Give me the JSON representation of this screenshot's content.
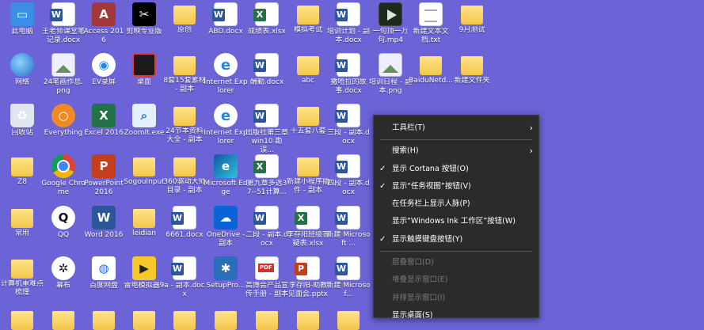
{
  "desktop": {
    "icons": [
      {
        "label": "此电脑",
        "kind": "pc",
        "glyph": "▭"
      },
      {
        "label": "王老师课堂笔记录.docx",
        "kind": "word",
        "glyph": ""
      },
      {
        "label": "Access 2016",
        "kind": "access",
        "glyph": "A"
      },
      {
        "label": "剪映专业版",
        "kind": "capcut",
        "glyph": "✂"
      },
      {
        "label": "原创",
        "kind": "folder",
        "glyph": ""
      },
      {
        "label": "ABD.docx",
        "kind": "word",
        "glyph": ""
      },
      {
        "label": "成绩表.xlsx",
        "kind": "excel",
        "glyph": ""
      },
      {
        "label": "模拟考试",
        "kind": "folder",
        "glyph": ""
      },
      {
        "label": "培训计划 - 副本.docx",
        "kind": "word",
        "glyph": ""
      },
      {
        "label": "一句顶一万句.mp4",
        "kind": "video",
        "glyph": ""
      },
      {
        "label": "新建文本文档.txt",
        "kind": "txt",
        "glyph": ""
      },
      {
        "label": "9月测试",
        "kind": "folder",
        "glyph": ""
      },
      {
        "label": "网络",
        "kind": "globe",
        "glyph": ""
      },
      {
        "label": "24笔画作息.png",
        "kind": "img",
        "glyph": ""
      },
      {
        "label": "EV录屏",
        "kind": "ev",
        "glyph": "◉"
      },
      {
        "label": "桌面",
        "kind": "dark",
        "glyph": ""
      },
      {
        "label": "8套15套素材 - 副本",
        "kind": "folder",
        "glyph": ""
      },
      {
        "label": "Internet Explorer",
        "kind": "ie",
        "glyph": "e"
      },
      {
        "label": "酬勤.docx",
        "kind": "word",
        "glyph": ""
      },
      {
        "label": "abc",
        "kind": "folder",
        "glyph": ""
      },
      {
        "label": "撒哈拉的故事.docx",
        "kind": "word",
        "glyph": ""
      },
      {
        "label": "培训日程 - 副本.png",
        "kind": "img",
        "glyph": ""
      },
      {
        "label": "BaiduNetd...",
        "kind": "folder",
        "glyph": ""
      },
      {
        "label": "新建文件夹",
        "kind": "folder",
        "glyph": ""
      },
      {
        "label": "回收站",
        "kind": "bin",
        "glyph": "♻"
      },
      {
        "label": "Everything",
        "kind": "everything",
        "glyph": "○"
      },
      {
        "label": "Excel 2016",
        "kind": "excel16",
        "glyph": "X"
      },
      {
        "label": "ZoomIt.exe",
        "kind": "zoom",
        "glyph": "⌕"
      },
      {
        "label": "24节本资料大全 - 副本",
        "kind": "folder",
        "glyph": ""
      },
      {
        "label": "Internet Explorer",
        "kind": "ie",
        "glyph": "e"
      },
      {
        "label": "出版社第三章win10 勘误...",
        "kind": "word",
        "glyph": ""
      },
      {
        "label": "十五套八套",
        "kind": "folder",
        "glyph": ""
      },
      {
        "label": "三段 - 副本.docx",
        "kind": "word",
        "glyph": ""
      },
      {
        "label": "Z8",
        "kind": "folder",
        "glyph": ""
      },
      {
        "label": "Google Chrome",
        "kind": "chrome",
        "glyph": ""
      },
      {
        "label": "PowerPoint 2016",
        "kind": "ppt16",
        "glyph": "P"
      },
      {
        "label": "SogouInput",
        "kind": "folder",
        "glyph": ""
      },
      {
        "label": "360驱动大师目录 - 副本",
        "kind": "folder",
        "glyph": ""
      },
      {
        "label": "Microsoft Edge",
        "kind": "edge",
        "glyph": "e"
      },
      {
        "label": "第九章多选37--51计算...",
        "kind": "excel",
        "glyph": ""
      },
      {
        "label": "新建小程序插件 - 副本",
        "kind": "folder",
        "glyph": ""
      },
      {
        "label": "四段 - 副本.docx",
        "kind": "word",
        "glyph": ""
      },
      {
        "label": "常用",
        "kind": "folder",
        "glyph": ""
      },
      {
        "label": "QQ",
        "kind": "qq",
        "glyph": "Q"
      },
      {
        "label": "Word 2016",
        "kind": "word16",
        "glyph": "W"
      },
      {
        "label": "leidian",
        "kind": "folder",
        "glyph": ""
      },
      {
        "label": "6661.docx",
        "kind": "word",
        "glyph": ""
      },
      {
        "label": "OneDrive - 副本",
        "kind": "onedrive",
        "glyph": "☁"
      },
      {
        "label": "二段 - 副本.docx",
        "kind": "word",
        "glyph": ""
      },
      {
        "label": "李存阳班级答疑表.xlsx",
        "kind": "excel",
        "glyph": ""
      },
      {
        "label": "新建 Microsoft ...",
        "kind": "word",
        "glyph": ""
      },
      {
        "label": "计算机重难点梳理",
        "kind": "folder",
        "glyph": ""
      },
      {
        "label": "幕布",
        "kind": "fly",
        "glyph": "✲"
      },
      {
        "label": "百度网盘",
        "kind": "baidu",
        "glyph": "◍"
      },
      {
        "label": "雷电模拟器9",
        "kind": "leidian",
        "glyph": "▶"
      },
      {
        "label": "a - 副本.docx",
        "kind": "word",
        "glyph": ""
      },
      {
        "label": "SetupPro...",
        "kind": "setup",
        "glyph": "✱"
      },
      {
        "label": "高博会产品宣传手册 - 副本",
        "kind": "pdf",
        "glyph": ""
      },
      {
        "label": "李存阳-助教见面会.pptx",
        "kind": "ppt",
        "glyph": ""
      },
      {
        "label": "新建 Microsof...",
        "kind": "word",
        "glyph": ""
      }
    ]
  },
  "context_menu": {
    "items": [
      {
        "label": "工具栏(T)",
        "checked": false,
        "submenu": true,
        "disabled": false
      },
      {
        "sep": true
      },
      {
        "label": "搜索(H)",
        "checked": false,
        "submenu": true,
        "disabled": false
      },
      {
        "label": "显示 Cortana 按钮(O)",
        "checked": true,
        "submenu": false,
        "disabled": false
      },
      {
        "label": "显示“任务视图”按钮(V)",
        "checked": true,
        "submenu": false,
        "disabled": false
      },
      {
        "label": "在任务栏上显示人脉(P)",
        "checked": false,
        "submenu": false,
        "disabled": false
      },
      {
        "label": "显示“Windows Ink 工作区”按钮(W)",
        "checked": false,
        "submenu": false,
        "disabled": false
      },
      {
        "label": "显示触摸键盘按钮(Y)",
        "checked": true,
        "submenu": false,
        "disabled": false
      },
      {
        "sep": true
      },
      {
        "label": "层叠窗口(D)",
        "checked": false,
        "submenu": false,
        "disabled": true
      },
      {
        "label": "堆叠显示窗口(E)",
        "checked": false,
        "submenu": false,
        "disabled": true
      },
      {
        "label": "并排显示窗口(I)",
        "checked": false,
        "submenu": false,
        "disabled": true
      },
      {
        "label": "显示桌面(S)",
        "checked": false,
        "submenu": false,
        "disabled": false
      }
    ],
    "check_glyph": "✓",
    "arrow_glyph": "›"
  },
  "colors": {
    "desktop": "#6b63d6",
    "menu_bg": "#2b2b2b",
    "menu_text": "#ffffff",
    "menu_disabled": "#7a7a7a"
  }
}
